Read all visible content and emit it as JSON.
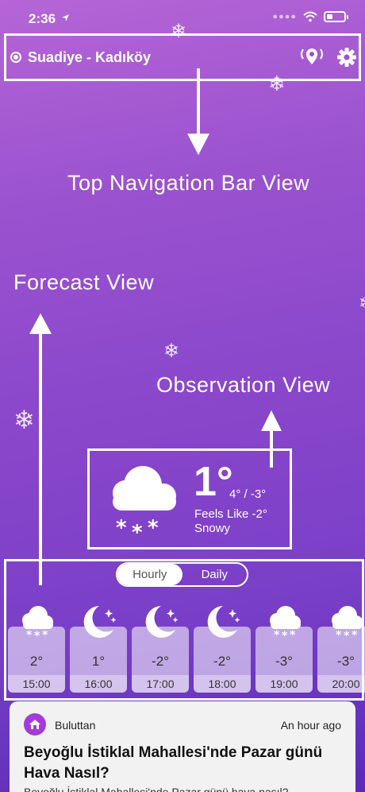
{
  "status_bar": {
    "time": "2:36",
    "battery_level": 0.35
  },
  "top_nav": {
    "location": "Suadiye - Kadıköy"
  },
  "annotations": {
    "top_nav": "Top Navigation Bar View",
    "forecast": "Forecast View",
    "observation": "Observation View"
  },
  "observation": {
    "temperature": "1°",
    "range": "4° / -3°",
    "feels_like": "Feels Like -2°",
    "condition": "Snowy"
  },
  "forecast": {
    "toggle": {
      "hourly": "Hourly",
      "daily": "Daily",
      "selected": "Hourly"
    },
    "hours": [
      {
        "temp": "2°",
        "time": "15:00",
        "icon": "snow-cloud-icon"
      },
      {
        "temp": "1°",
        "time": "16:00",
        "icon": "moon-stars-icon"
      },
      {
        "temp": "-2°",
        "time": "17:00",
        "icon": "moon-stars-icon"
      },
      {
        "temp": "-2°",
        "time": "18:00",
        "icon": "moon-stars-icon"
      },
      {
        "temp": "-3°",
        "time": "19:00",
        "icon": "snow-cloud-icon"
      },
      {
        "temp": "-3°",
        "time": "20:00",
        "icon": "snow-cloud-icon"
      }
    ]
  },
  "news": {
    "source": "Buluttan",
    "time": "An hour ago",
    "title": "Beyoğlu İstiklal Mahallesi'nde Pazar günü Hava Nasıl?",
    "body": "Beyoğlu İstiklal Mahallesi'nde Pazar günü hava nasıl?"
  },
  "colors": {
    "bg_top": "#b565d6",
    "bg_bottom": "#5a2bb8",
    "news_logo": "#a43ad8"
  }
}
